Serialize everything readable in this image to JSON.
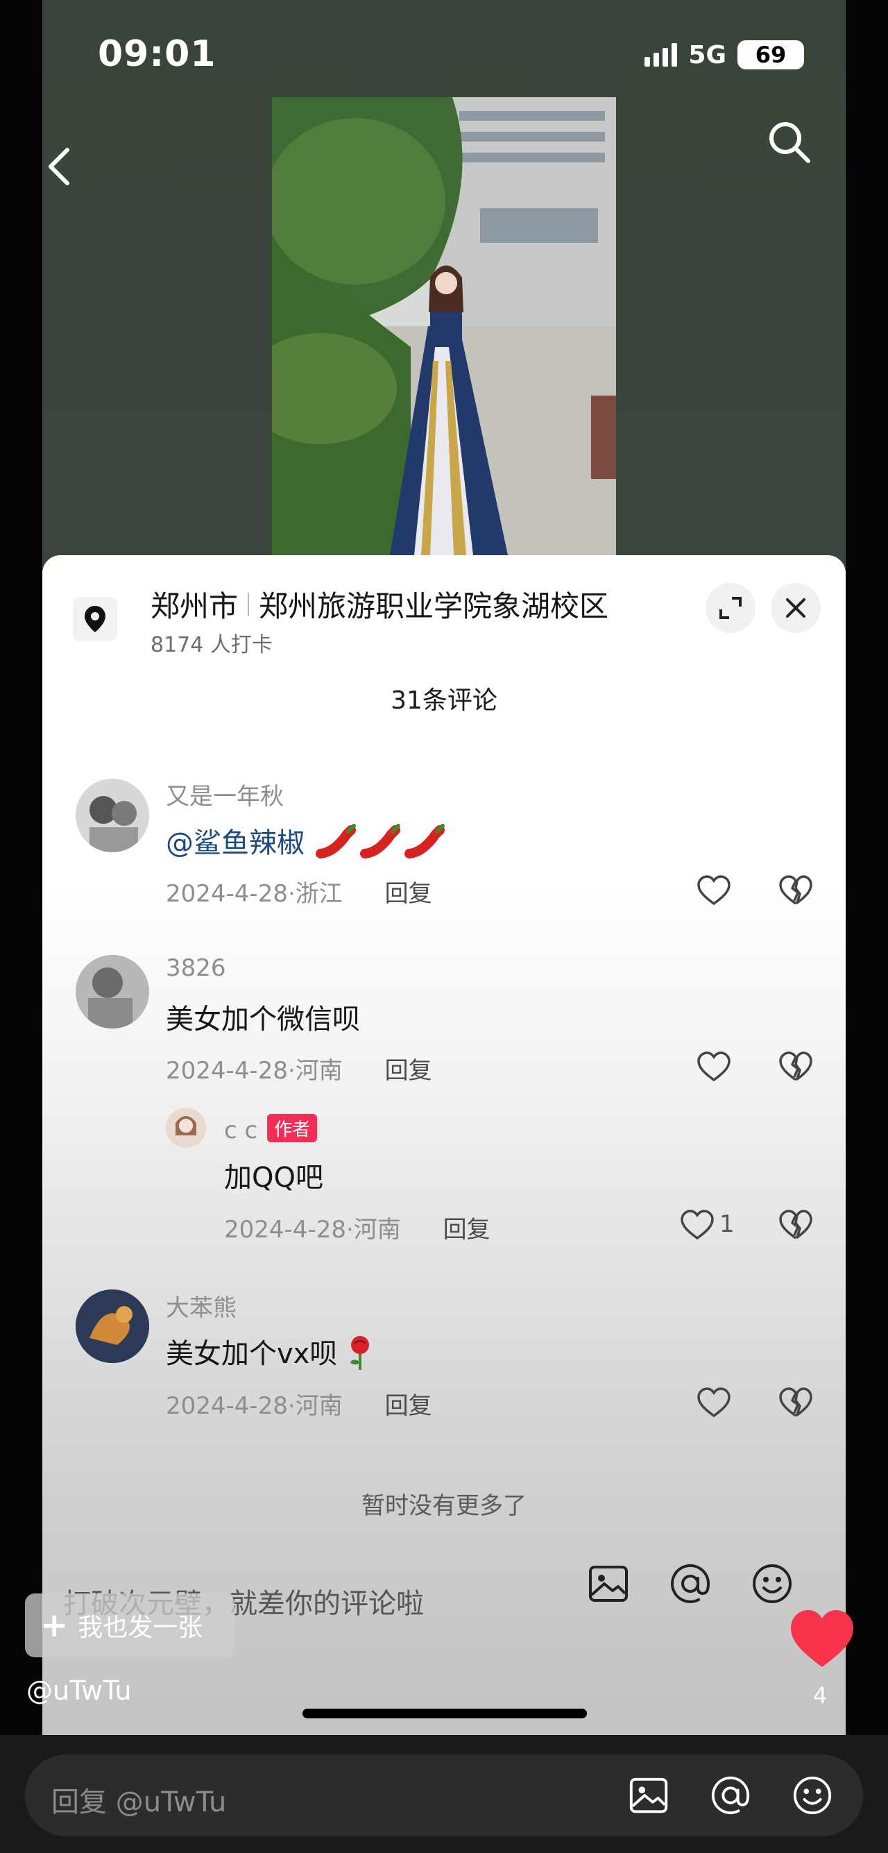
{
  "status": {
    "time": "09:01",
    "network": "5G",
    "battery": "69"
  },
  "location": {
    "city": "郑州市",
    "place": "郑州旅游职业学院象湖校区",
    "checkins": "8174 人打卡"
  },
  "comments_title": "31条评论",
  "comments": [
    {
      "user": "又是一年秋",
      "mention": "@鲨鱼辣椒",
      "text": "",
      "date": "2024-4-28",
      "region": "浙江"
    },
    {
      "user": "3826",
      "text": "美女加个微信呗",
      "date": "2024-4-28",
      "region": "河南"
    },
    {
      "user": "c c",
      "badge": "作者",
      "text": "加QQ吧",
      "date": "2024-4-28",
      "region": "河南",
      "likes": "1"
    },
    {
      "user": "大苯熊",
      "text": "美女加个vx呗",
      "date": "2024-4-28",
      "region": "河南"
    }
  ],
  "reply_label": "回复",
  "date_region_sep": "·",
  "no_more": "暂时没有更多了",
  "inner_input_placeholder": "打破次元壁，就差你的评论啦",
  "post_button": {
    "plus": "+",
    "label": "我也发一张"
  },
  "uploader": "@uTwTu",
  "like_count": "4",
  "reply_bar_placeholder": "回复 @uTwTu",
  "colors": {
    "author_badge": "#f32d56",
    "heart": "#f7344a",
    "mention": "#1d4b80"
  },
  "icons": {
    "back": "chevron-left-icon",
    "search": "search-icon",
    "location": "location-pin-icon",
    "expand": "expand-icon",
    "close": "close-icon",
    "like": "heart-outline-icon",
    "dislike": "broken-heart-icon",
    "image": "image-icon",
    "at": "at-icon",
    "emoji": "emoji-icon"
  }
}
